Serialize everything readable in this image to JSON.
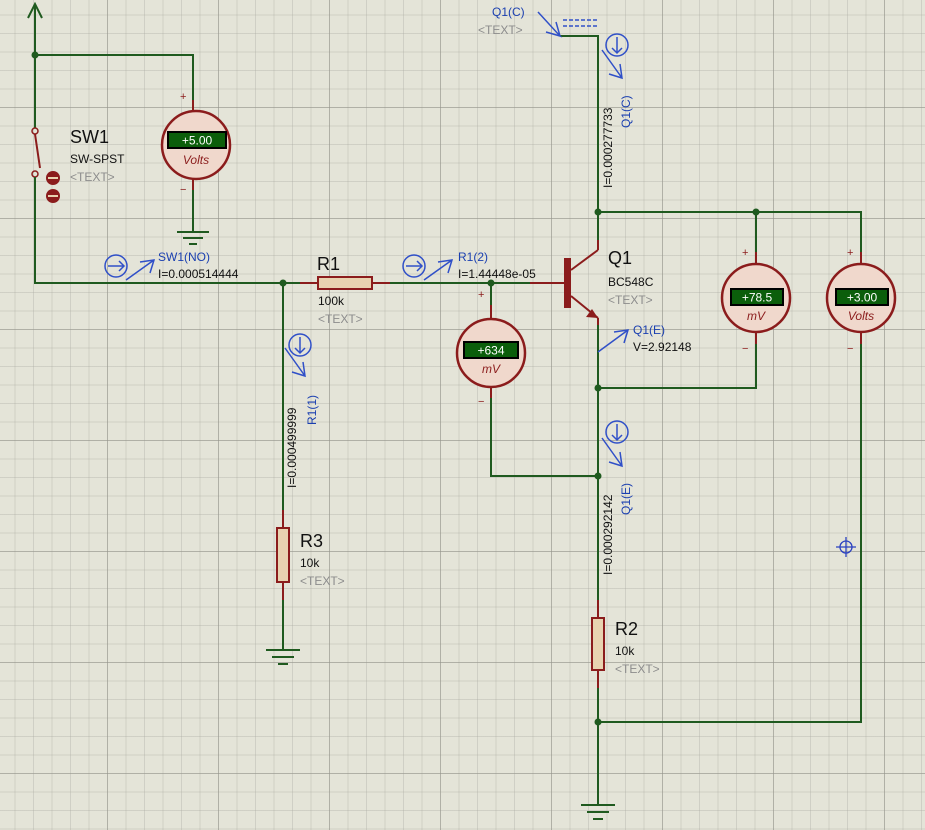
{
  "components": {
    "sw1": {
      "ref": "SW1",
      "value": "SW-SPST",
      "text": "<TEXT>"
    },
    "r1": {
      "ref": "R1",
      "value": "100k",
      "text": "<TEXT>"
    },
    "r2": {
      "ref": "R2",
      "value": "10k",
      "text": "<TEXT>"
    },
    "r3": {
      "ref": "R3",
      "value": "10k",
      "text": "<TEXT>"
    },
    "q1": {
      "ref": "Q1",
      "value": "BC548C",
      "text": "<TEXT>"
    }
  },
  "meters": {
    "supply": {
      "reading": "+5.00",
      "unit": "Volts"
    },
    "vbe": {
      "reading": "+634",
      "unit": "mV"
    },
    "vce": {
      "reading": "+78.5",
      "unit": "mV"
    },
    "vout": {
      "reading": "+3.00",
      "unit": "Volts"
    },
    "plus": "+",
    "minus": "−"
  },
  "probes": {
    "sw1no": {
      "name": "SW1(NO)",
      "reading": "I=0.000514444"
    },
    "r1pin2": {
      "name": "R1(2)",
      "reading": "I=1.44448e-05"
    },
    "r1pin1": {
      "name": "R1(1)",
      "reading": "I=0.000499999"
    },
    "q1c_top": {
      "name": "Q1(C)",
      "text": "<TEXT>"
    },
    "q1c": {
      "name": "Q1(C)",
      "reading": "I=0.000277733"
    },
    "q1e_volt": {
      "name": "Q1(E)",
      "reading": "V=2.92148"
    },
    "q1e": {
      "name": "Q1(E)",
      "reading": "I=0.000292142"
    }
  },
  "colors": {
    "wire": "#1f5a1f",
    "component": "#8b1c1c",
    "probe": "#1a3fb0",
    "grid_background": "#e4e4d8",
    "meter_display": "#0b5e0b"
  }
}
